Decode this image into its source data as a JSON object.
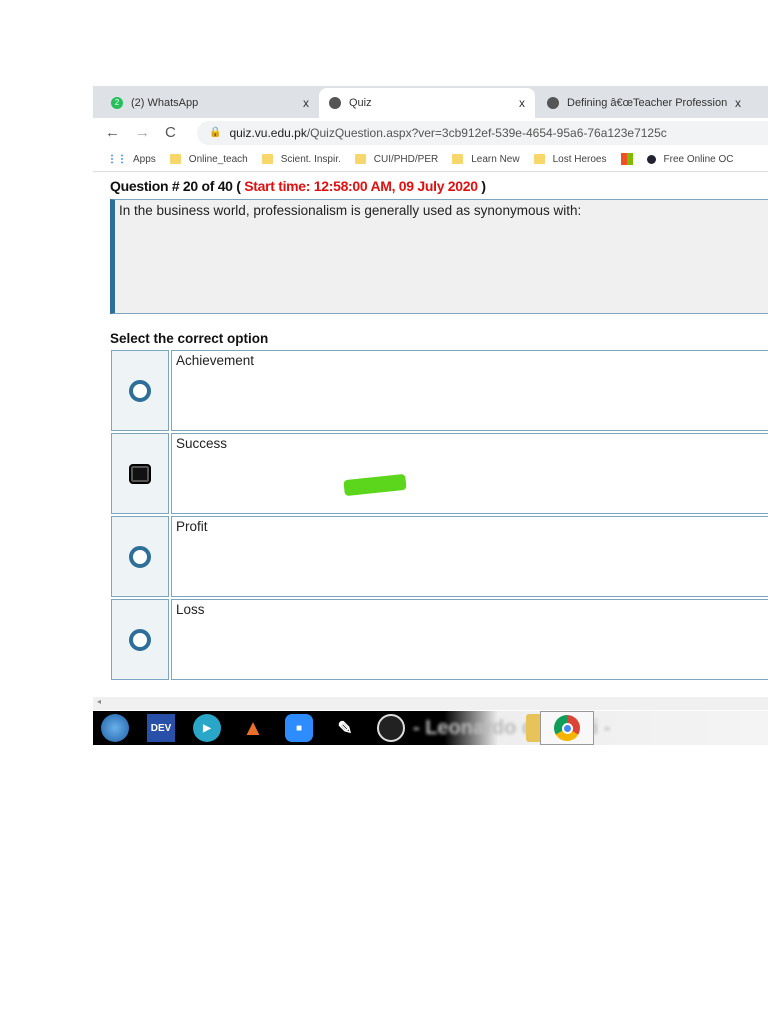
{
  "browser": {
    "tabs": [
      {
        "label": "(2) WhatsApp",
        "badge": "2"
      },
      {
        "label": "Quiz"
      },
      {
        "label": "Defining â€œTeacher Profession"
      }
    ],
    "close_glyph": "x",
    "url_domain": "quiz.vu.edu.pk",
    "url_path": "/QuizQuestion.aspx?ver=3cb912ef-539e-4654-95a6-76a123e7125c",
    "bookmarks": [
      "Apps",
      "Online_teach",
      "Scient. Inspir.",
      "CUI/PHD/PER",
      "Learn New",
      "Lost Heroes",
      "Free Online OC"
    ]
  },
  "quiz": {
    "heading": "Question # 20 of 40 (",
    "start_time": "Start time: 12:58:00 AM, 09 July 2020",
    "heading_close": ")",
    "question": "In the business world, professionalism is generally used as synonymous with:",
    "select_label": "Select the correct option",
    "options": [
      {
        "label": "Achievement",
        "selected": false
      },
      {
        "label": "Success",
        "selected": true
      },
      {
        "label": "Profit",
        "selected": false
      },
      {
        "label": "Loss",
        "selected": false
      }
    ]
  },
  "taskbar": {
    "dev_label": "DEV",
    "blurred_title": "- Leonardo da Vinci -"
  }
}
